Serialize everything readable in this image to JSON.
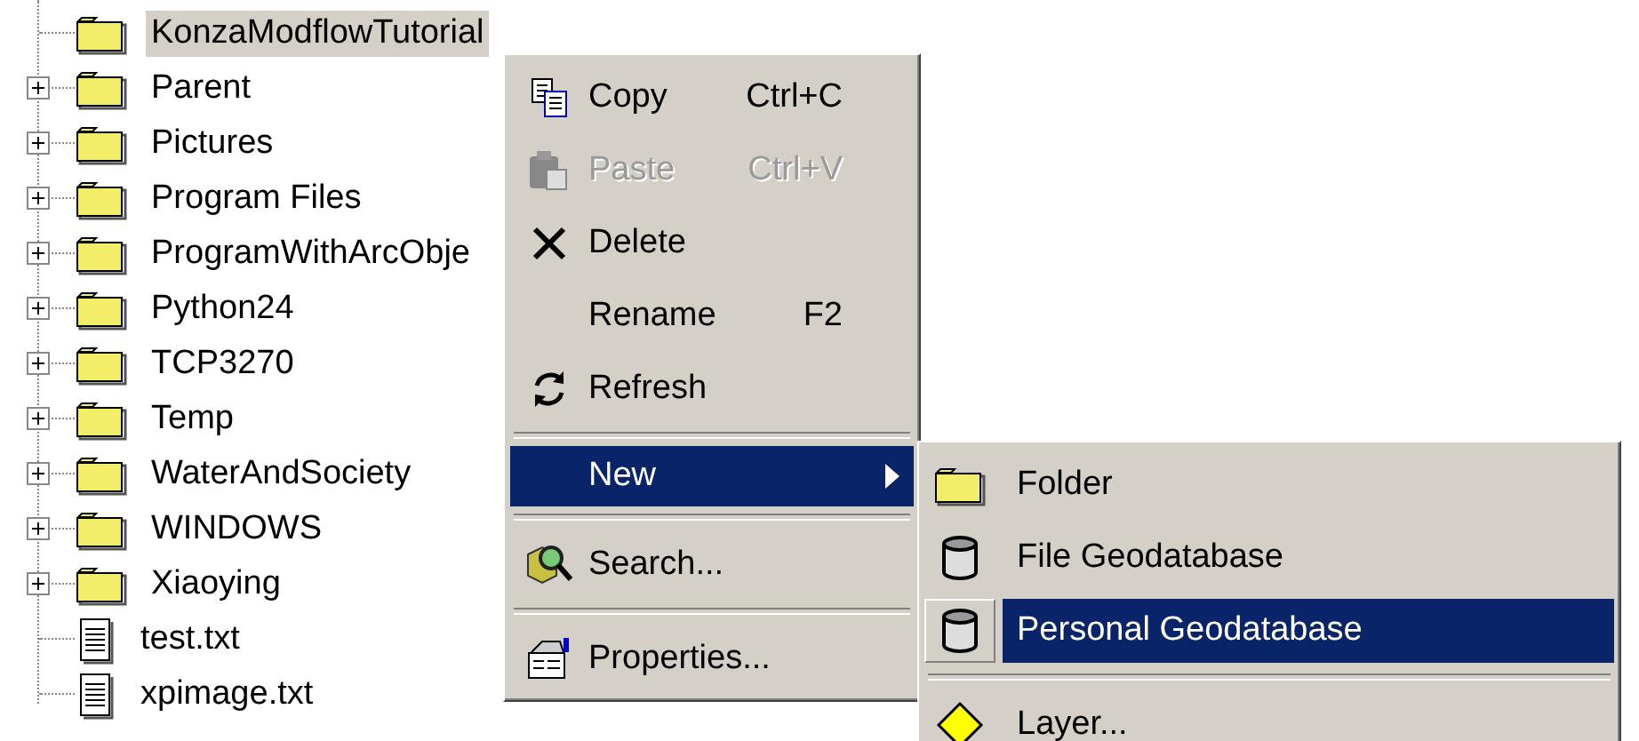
{
  "tree": {
    "items": [
      {
        "kind": "folder",
        "label": "KonzaModflowTutorial",
        "expandable": false,
        "selected": true
      },
      {
        "kind": "folder",
        "label": "Parent",
        "expandable": true,
        "selected": false
      },
      {
        "kind": "folder",
        "label": "Pictures",
        "expandable": true,
        "selected": false
      },
      {
        "kind": "folder",
        "label": "Program Files",
        "expandable": true,
        "selected": false
      },
      {
        "kind": "folder",
        "label": "ProgramWithArcObje",
        "expandable": true,
        "selected": false
      },
      {
        "kind": "folder",
        "label": "Python24",
        "expandable": true,
        "selected": false
      },
      {
        "kind": "folder",
        "label": "TCP3270",
        "expandable": true,
        "selected": false
      },
      {
        "kind": "folder",
        "label": "Temp",
        "expandable": true,
        "selected": false
      },
      {
        "kind": "folder",
        "label": "WaterAndSociety",
        "expandable": true,
        "selected": false
      },
      {
        "kind": "folder",
        "label": "WINDOWS",
        "expandable": true,
        "selected": false
      },
      {
        "kind": "folder",
        "label": "Xiaoying",
        "expandable": true,
        "selected": false
      },
      {
        "kind": "file",
        "label": "test.txt",
        "expandable": false,
        "selected": false
      },
      {
        "kind": "file",
        "label": "xpimage.txt",
        "expandable": false,
        "selected": false
      }
    ]
  },
  "context_menu": {
    "items": [
      {
        "kind": "copy",
        "label": "Copy",
        "shortcut": "Ctrl+C",
        "disabled": false,
        "selected": false
      },
      {
        "kind": "paste",
        "label": "Paste",
        "shortcut": "Ctrl+V",
        "disabled": true,
        "selected": false
      },
      {
        "kind": "delete",
        "label": "Delete",
        "disabled": false,
        "selected": false
      },
      {
        "kind": "plain",
        "label": "Rename",
        "shortcut": "F2",
        "disabled": false,
        "selected": false
      },
      {
        "kind": "refresh",
        "label": "Refresh",
        "disabled": false,
        "selected": false
      },
      {
        "kind": "separator"
      },
      {
        "kind": "submenu",
        "label": "New",
        "disabled": false,
        "selected": true
      },
      {
        "kind": "separator"
      },
      {
        "kind": "search",
        "label": "Search...",
        "disabled": false,
        "selected": false
      },
      {
        "kind": "separator"
      },
      {
        "kind": "properties",
        "label": "Properties...",
        "disabled": false,
        "selected": false
      }
    ]
  },
  "submenu": {
    "items": [
      {
        "kind": "folder",
        "label": "Folder",
        "selected": false
      },
      {
        "kind": "database",
        "label": "File Geodatabase",
        "selected": false
      },
      {
        "kind": "database",
        "label": "Personal Geodatabase",
        "selected": true
      },
      {
        "kind": "separator"
      },
      {
        "kind": "layer",
        "label": "Layer...",
        "selected": false
      }
    ]
  }
}
